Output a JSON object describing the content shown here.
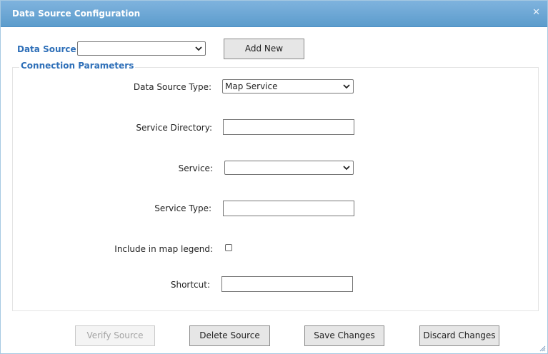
{
  "dialog": {
    "title": "Data Source Configuration",
    "close_icon": "close-icon"
  },
  "data_source": {
    "label": "Data Source:",
    "selected": "",
    "add_new_label": "Add New"
  },
  "connection": {
    "legend": "Connection Parameters",
    "data_source_type": {
      "label": "Data Source Type:",
      "selected": "Map Service"
    },
    "service_directory": {
      "label": "Service Directory:",
      "value": ""
    },
    "service": {
      "label": "Service:",
      "selected": ""
    },
    "service_type": {
      "label": "Service Type:",
      "value": ""
    },
    "include_in_legend": {
      "label": "Include in map legend:",
      "checked": false
    },
    "shortcut": {
      "label": "Shortcut:",
      "value": ""
    }
  },
  "actions": {
    "verify_label": "Verify Source",
    "delete_label": "Delete Source",
    "save_label": "Save Changes",
    "discard_label": "Discard Changes"
  },
  "colors": {
    "title_bar": "#5c9ccc",
    "label_accent": "#2e6fb8"
  }
}
